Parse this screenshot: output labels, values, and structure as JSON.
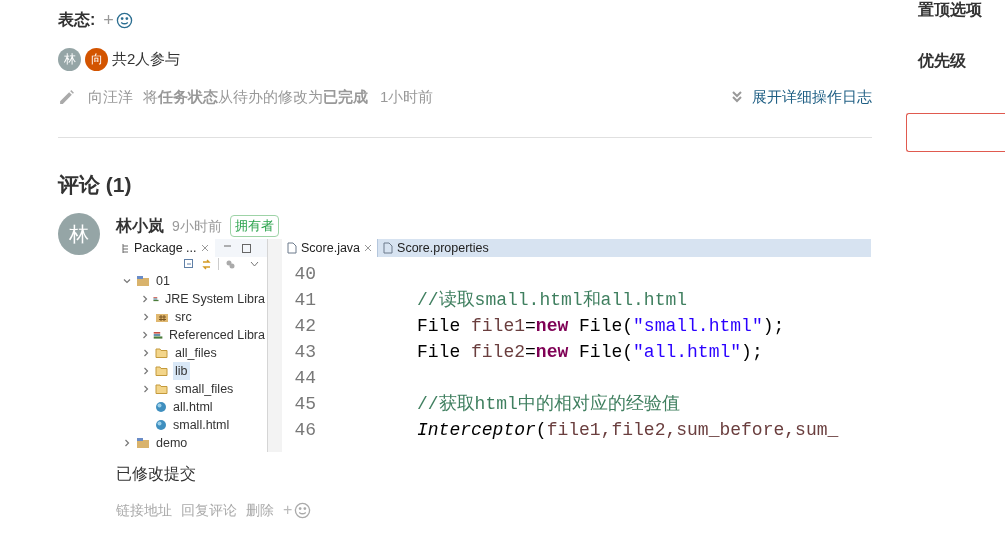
{
  "reactions": {
    "label": "表态:",
    "add": "+"
  },
  "participants": {
    "avatars": [
      {
        "initial": "林",
        "color": "#95a5a6"
      },
      {
        "initial": "向",
        "color": "#d35400"
      }
    ],
    "summary": "共2人参与"
  },
  "activity": {
    "user": "向汪洋",
    "text": "将**任务状态**从待办的修改为**已完成**",
    "time": "1小时前",
    "expand": "展开详细操作日志"
  },
  "sidebar": {
    "items": [
      "置顶选项",
      "优先级"
    ]
  },
  "comments": {
    "title": "评论 (1)",
    "items": [
      {
        "avatar": "林",
        "author": "林小岚",
        "time": "9小时前",
        "badge": "拥有者",
        "screenshot": {
          "explorer": {
            "tab": "Package ...",
            "tree": [
              {
                "label": "01",
                "kind": "project",
                "expanded": true,
                "selected": false,
                "children": [
                  {
                    "label": "JRE System Libra",
                    "kind": "library",
                    "expanded": false,
                    "selected": false
                  },
                  {
                    "label": "src",
                    "kind": "source",
                    "expanded": false,
                    "selected": false
                  },
                  {
                    "label": "Referenced Libra",
                    "kind": "library",
                    "expanded": false,
                    "selected": false
                  },
                  {
                    "label": "all_files",
                    "kind": "folder",
                    "expanded": false,
                    "selected": false
                  },
                  {
                    "label": "lib",
                    "kind": "folder",
                    "expanded": false,
                    "selected": true
                  },
                  {
                    "label": "small_files",
                    "kind": "folder",
                    "expanded": false,
                    "selected": false
                  },
                  {
                    "label": "all.html",
                    "kind": "file",
                    "selected": false
                  },
                  {
                    "label": "small.html",
                    "kind": "file",
                    "selected": false
                  }
                ]
              },
              {
                "label": "demo",
                "kind": "project",
                "expanded": false,
                "selected": false
              }
            ]
          },
          "tabs": [
            {
              "label": "Score.java",
              "selected": true
            },
            {
              "label": "Score.properties",
              "selected": false
            }
          ],
          "lines": [
            {
              "number": "40"
            },
            {
              "number": "41",
              "tokens": [
                {
                  "text": "//读取small.html和all.html",
                  "kind": "comment"
                }
              ]
            },
            {
              "number": "42",
              "tokens": [
                {
                  "text": "File ",
                  "kind": "plain"
                },
                {
                  "text": "file1",
                  "kind": "variable"
                },
                {
                  "text": "=",
                  "kind": "plain"
                },
                {
                  "text": "new",
                  "kind": "keyword"
                },
                {
                  "text": " File(",
                  "kind": "plain"
                },
                {
                  "text": "\"small.html\"",
                  "kind": "string"
                },
                {
                  "text": ");",
                  "kind": "plain"
                }
              ]
            },
            {
              "number": "43",
              "tokens": [
                {
                  "text": "File ",
                  "kind": "plain"
                },
                {
                  "text": "file2",
                  "kind": "variable"
                },
                {
                  "text": "=",
                  "kind": "plain"
                },
                {
                  "text": "new",
                  "kind": "keyword"
                },
                {
                  "text": " File(",
                  "kind": "plain"
                },
                {
                  "text": "\"all.html\"",
                  "kind": "string"
                },
                {
                  "text": ");",
                  "kind": "plain"
                }
              ]
            },
            {
              "number": "44"
            },
            {
              "number": "45",
              "tokens": [
                {
                  "text": "//获取html中的相对应的经验值",
                  "kind": "comment"
                }
              ]
            },
            {
              "number": "46",
              "tokens": [
                {
                  "text": "Interceptor",
                  "kind": "italic"
                },
                {
                  "text": "(",
                  "kind": "plain"
                },
                {
                  "text": "file1,file2,sum_before,sum_",
                  "kind": "variable"
                }
              ]
            }
          ]
        },
        "body": "已修改提交",
        "actions": [
          "链接地址",
          "回复评论",
          "删除"
        ],
        "add": "+"
      }
    ]
  }
}
